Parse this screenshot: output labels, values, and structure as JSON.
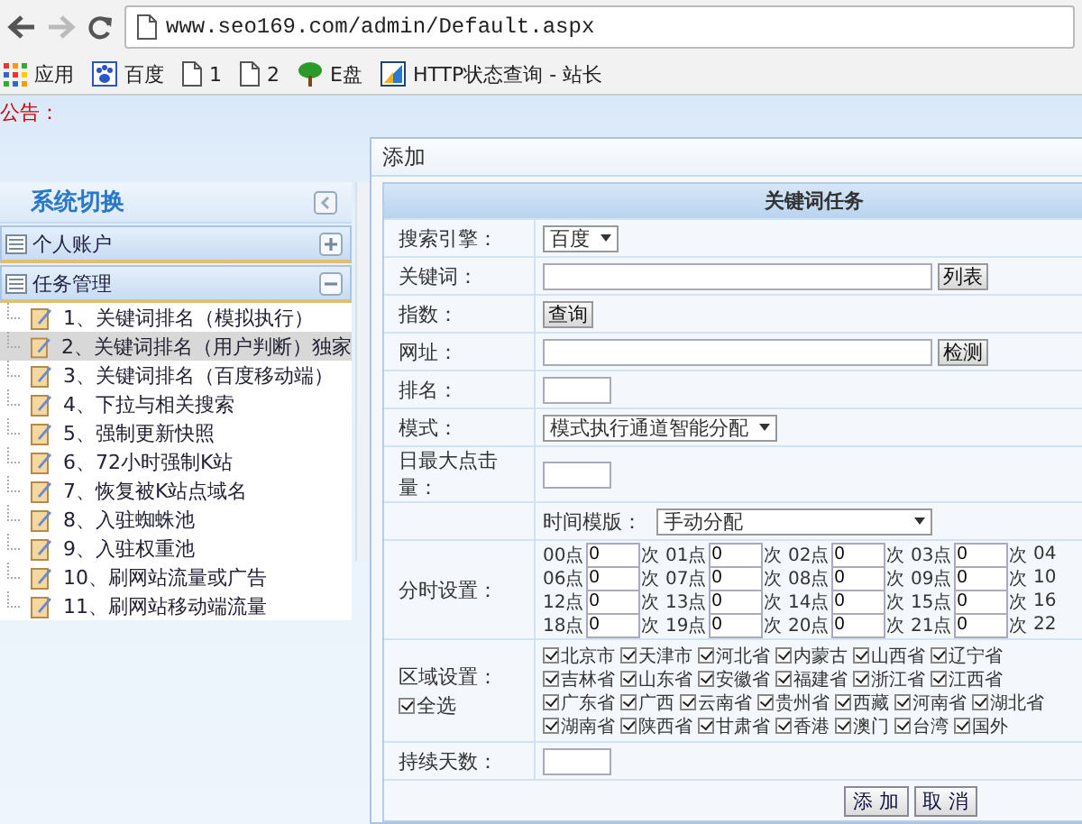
{
  "browser": {
    "address": "www.seo169.com/admin/Default.aspx",
    "bookmarks": [
      {
        "kind": "apps",
        "label": "应用"
      },
      {
        "kind": "paw",
        "label": "百度"
      },
      {
        "kind": "page",
        "label": "1"
      },
      {
        "kind": "page",
        "label": "2"
      },
      {
        "kind": "tree",
        "label": "E盘"
      },
      {
        "kind": "chart",
        "label": "HTTP状态查询 - 站长"
      }
    ]
  },
  "notice": "公告：",
  "sidebar": {
    "title": "系统切换",
    "groups": [
      {
        "label": "个人账户",
        "expanded": false
      },
      {
        "label": "任务管理",
        "expanded": true,
        "children": [
          {
            "label": "1、关键词排名（模拟执行）",
            "selected": false
          },
          {
            "label": "2、关键词排名（用户判断）独家",
            "selected": true
          },
          {
            "label": "3、关键词排名（百度移动端）",
            "selected": false
          },
          {
            "label": "4、下拉与相关搜索",
            "selected": false
          },
          {
            "label": "5、强制更新快照",
            "selected": false
          },
          {
            "label": "6、72小时强制K站",
            "selected": false
          },
          {
            "label": "7、恢复被K站点域名",
            "selected": false
          },
          {
            "label": "8、入驻蜘蛛池",
            "selected": false
          },
          {
            "label": "9、入驻权重池",
            "selected": false
          },
          {
            "label": "10、刷网站流量或广告",
            "selected": false
          },
          {
            "label": "11、刷网站移动端流量",
            "selected": false
          }
        ]
      }
    ]
  },
  "panel": {
    "title": "添加",
    "form": {
      "title": "关键词任务",
      "rows": [
        {
          "kind": "select",
          "label": "搜索引擎：",
          "value": "百度"
        },
        {
          "kind": "input_button",
          "label": "关键词：",
          "button": "列表"
        },
        {
          "kind": "button",
          "label": "指数：",
          "button": "查询"
        },
        {
          "kind": "input_button",
          "label": "网址：",
          "button": "检测"
        },
        {
          "kind": "small_input",
          "label": "排名："
        },
        {
          "kind": "select",
          "label": "模式：",
          "value": "模式执行通道智能分配"
        },
        {
          "kind": "small_input",
          "label": "日最大点击量："
        },
        {
          "kind": "template",
          "inline_label": "时间模版：",
          "value": "手动分配"
        },
        {
          "kind": "hours",
          "label": "分时设置：",
          "hours": [
            {
              "label": "00点",
              "value": "0",
              "unit": "次"
            },
            {
              "label": "01点",
              "value": "0",
              "unit": "次"
            },
            {
              "label": "02点",
              "value": "0",
              "unit": "次"
            },
            {
              "label": "03点",
              "value": "0",
              "unit": "次"
            },
            {
              "label": "04"
            },
            {
              "label": "06点",
              "value": "0",
              "unit": "次"
            },
            {
              "label": "07点",
              "value": "0",
              "unit": "次"
            },
            {
              "label": "08点",
              "value": "0",
              "unit": "次"
            },
            {
              "label": "09点",
              "value": "0",
              "unit": "次"
            },
            {
              "label": "10"
            },
            {
              "label": "12点",
              "value": "0",
              "unit": "次"
            },
            {
              "label": "13点",
              "value": "0",
              "unit": "次"
            },
            {
              "label": "14点",
              "value": "0",
              "unit": "次"
            },
            {
              "label": "15点",
              "value": "0",
              "unit": "次"
            },
            {
              "label": "16"
            },
            {
              "label": "18点",
              "value": "0",
              "unit": "次"
            },
            {
              "label": "19点",
              "value": "0",
              "unit": "次"
            },
            {
              "label": "20点",
              "value": "0",
              "unit": "次"
            },
            {
              "label": "21点",
              "value": "0",
              "unit": "次"
            },
            {
              "label": "22"
            }
          ]
        },
        {
          "kind": "regions",
          "label": "区域设置：",
          "select_all": {
            "label": "全选",
            "checked": true
          },
          "regions": [
            {
              "label": "北京市",
              "checked": true
            },
            {
              "label": "天津市",
              "checked": true
            },
            {
              "label": "河北省",
              "checked": true
            },
            {
              "label": "内蒙古",
              "checked": true
            },
            {
              "label": "山西省",
              "checked": true
            },
            {
              "label": "辽宁省",
              "checked": true
            },
            {
              "label": "吉林省",
              "checked": true
            },
            {
              "label": "山东省",
              "checked": true
            },
            {
              "label": "安徽省",
              "checked": true
            },
            {
              "label": "福建省",
              "checked": true
            },
            {
              "label": "浙江省",
              "checked": true
            },
            {
              "label": "江西省",
              "checked": true
            },
            {
              "label": "广东省",
              "checked": true
            },
            {
              "label": "广西",
              "checked": true
            },
            {
              "label": "云南省",
              "checked": true
            },
            {
              "label": "贵州省",
              "checked": true
            },
            {
              "label": "西藏",
              "checked": true
            },
            {
              "label": "河南省",
              "checked": true
            },
            {
              "label": "湖北省",
              "checked": true
            },
            {
              "label": "湖南省",
              "checked": true
            },
            {
              "label": "陕西省",
              "checked": true
            },
            {
              "label": "甘肃省",
              "checked": true
            },
            {
              "label": "香港",
              "checked": true
            },
            {
              "label": "澳门",
              "checked": true
            },
            {
              "label": "台湾",
              "checked": true
            },
            {
              "label": "国外",
              "checked": true
            }
          ]
        },
        {
          "kind": "small_input",
          "label": "持续天数："
        }
      ],
      "buttons": [
        "添 加",
        "取 消"
      ]
    }
  }
}
